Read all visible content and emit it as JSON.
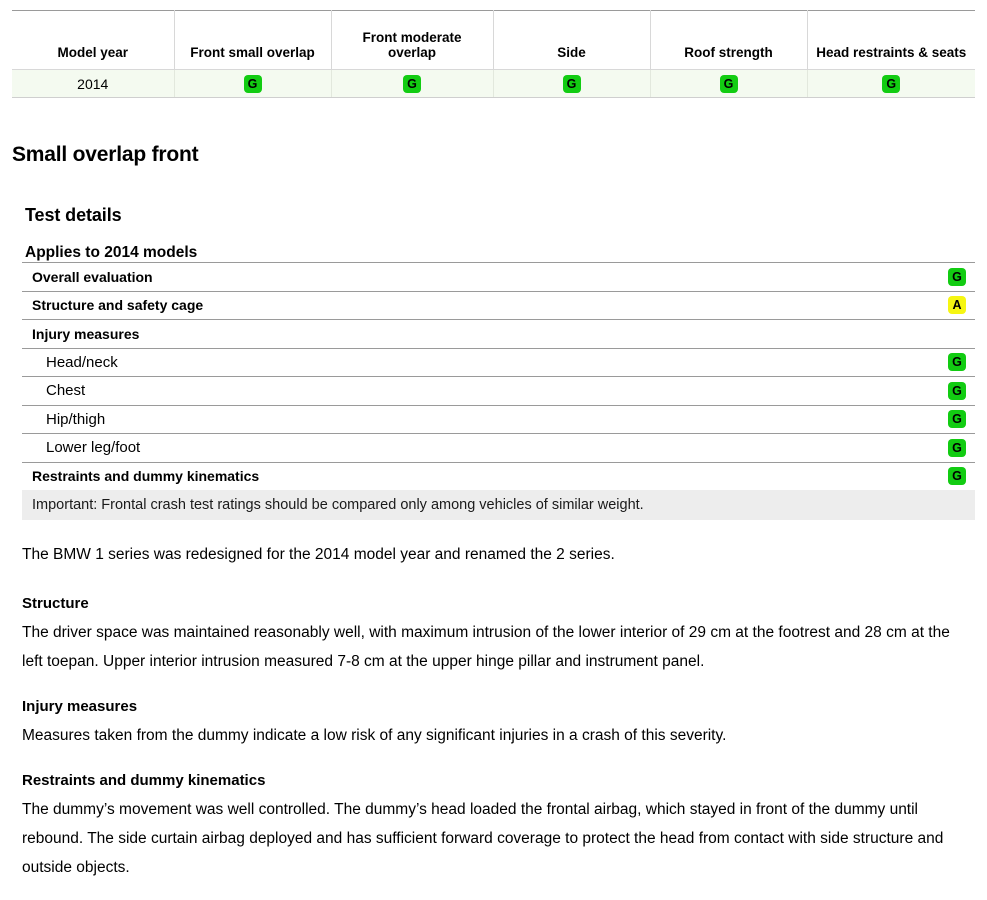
{
  "summary_table": {
    "headers": [
      "Model year",
      "Front small overlap",
      "Front moderate overlap",
      "Side",
      "Roof strength",
      "Head restraints & seats"
    ],
    "rows": [
      {
        "model_year": "2014",
        "front_small_overlap": "G",
        "front_moderate_overlap": "G",
        "side": "G",
        "roof_strength": "G",
        "head_restraints_seats": "G"
      }
    ]
  },
  "section": {
    "title": "Small overlap front",
    "subtitle": "Test details",
    "applies_to": "Applies to 2014 models"
  },
  "details": {
    "rows": [
      {
        "label": "Overall evaluation",
        "rating": "G",
        "level": 0
      },
      {
        "label": "Structure and safety cage",
        "rating": "A",
        "level": 0
      },
      {
        "label": "Injury measures",
        "rating": "",
        "level": 0
      },
      {
        "label": "Head/neck",
        "rating": "G",
        "level": 1
      },
      {
        "label": "Chest",
        "rating": "G",
        "level": 1
      },
      {
        "label": "Hip/thigh",
        "rating": "G",
        "level": 1
      },
      {
        "label": "Lower leg/foot",
        "rating": "G",
        "level": 1
      },
      {
        "label": "Restraints and dummy kinematics",
        "rating": "G",
        "level": 0
      }
    ],
    "important_note": "Important: Frontal crash test ratings should be compared only among vehicles of similar weight."
  },
  "copy": {
    "lead": "The BMW 1 series was redesigned for the 2014 model year and renamed the 2 series.",
    "structure_heading": "Structure",
    "structure_text": "The driver space was maintained reasonably well, with maximum intrusion of the lower interior of 29 cm at the footrest and 28 cm at the left toepan. Upper interior intrusion measured 7-8 cm at the upper hinge pillar and instrument panel.",
    "injury_heading": "Injury measures",
    "injury_text": "Measures taken from the dummy indicate a low risk of any significant injuries in a crash of this severity.",
    "restraints_heading": "Restraints and dummy kinematics",
    "restraints_text": "The dummy’s movement was well controlled. The dummy’s head loaded the frontal airbag, which stayed in front of the dummy until rebound. The side curtain airbag deployed and has sufficient forward coverage to protect the head from contact with side structure and outside objects."
  },
  "colors": {
    "good": "#12cc12",
    "acceptable": "#f6f612",
    "marginal": "#f4a01c",
    "poor": "#e02020",
    "row_tint": "#f4faf0",
    "note_bg": "#ededed"
  }
}
